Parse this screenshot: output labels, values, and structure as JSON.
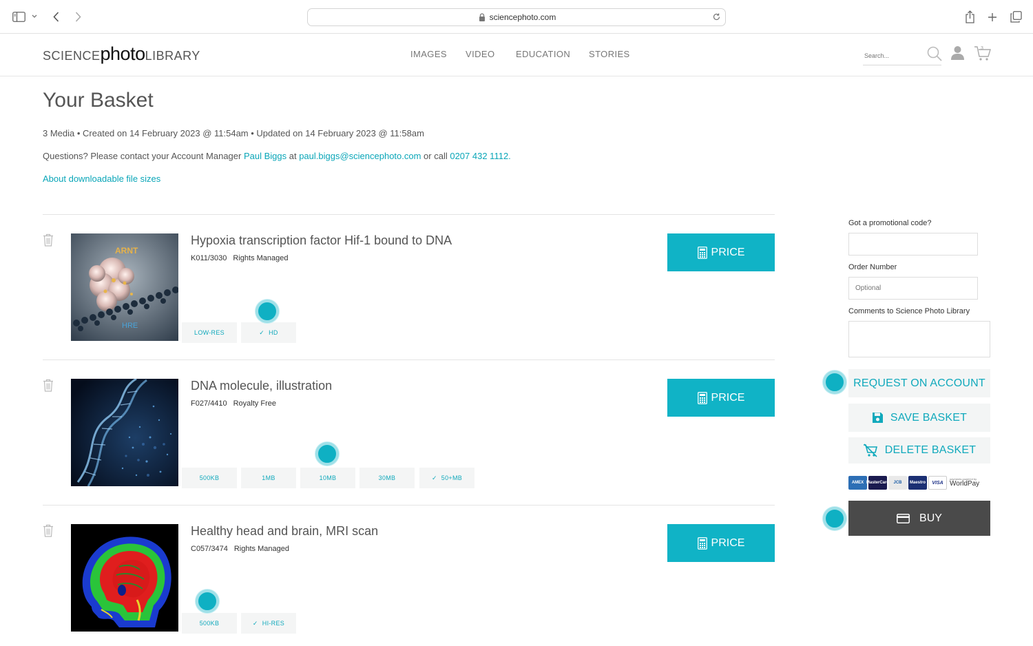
{
  "browser": {
    "url": "sciencephoto.com"
  },
  "header": {
    "logo": {
      "part1": "SCIENCE",
      "part2": "photo",
      "part3": "LIBRARY"
    },
    "nav": [
      "IMAGES",
      "VIDEO",
      "EDUCATION",
      "STORIES"
    ],
    "search_placeholder": "Search...",
    "cart_count": "3"
  },
  "page": {
    "title": "Your Basket",
    "meta": "3 Media • Created on 14 February 2023 @ 11:54am • Updated on 14 February 2023 @ 11:58am",
    "contact": {
      "prefix": "Questions? Please contact your Account Manager ",
      "manager": "Paul Biggs",
      "at": " at ",
      "email": "paul.biggs@sciencephoto.com",
      "or_call": " or call ",
      "phone": "0207 432 1112",
      "suffix": "."
    },
    "about_link": "About downloadable file sizes"
  },
  "items": [
    {
      "title": "Hypoxia transcription factor Hif-1 bound to DNA",
      "code": "K011/3030",
      "license": "Rights Managed",
      "price_label": "PRICE",
      "thumb_labels": [
        "ARNT",
        "HRE"
      ],
      "sizes": [
        {
          "label": "LOW-RES",
          "selected": false
        },
        {
          "label": "HD",
          "selected": true
        }
      ]
    },
    {
      "title": "DNA molecule, illustration",
      "code": "F027/4410",
      "license": "Royalty Free",
      "price_label": "PRICE",
      "sizes": [
        {
          "label": "500KB",
          "selected": false
        },
        {
          "label": "1MB",
          "selected": false
        },
        {
          "label": "10MB",
          "selected": false
        },
        {
          "label": "30MB",
          "selected": false
        },
        {
          "label": "50+MB",
          "selected": true
        }
      ]
    },
    {
      "title": "Healthy head and brain, MRI scan",
      "code": "C057/3474",
      "license": "Rights Managed",
      "price_label": "PRICE",
      "sizes": [
        {
          "label": "500KB",
          "selected": false
        },
        {
          "label": "HI-RES",
          "selected": true
        }
      ]
    }
  ],
  "sidebar": {
    "promo_label": "Got a promotional code?",
    "promo_value": "",
    "order_label": "Order Number",
    "order_placeholder": "Optional",
    "comments_label": "Comments to Science Photo Library",
    "request_label": "REQUEST ON ACCOUNT",
    "save_label": "SAVE BASKET",
    "delete_label": "DELETE BASKET",
    "buy_label": "BUY",
    "cards": [
      "AMEX",
      "MasterCard",
      "JCB",
      "Maestro",
      "VISA"
    ],
    "worldpay_small": "payments powered by",
    "worldpay": "WorldPay"
  },
  "colors": {
    "accent": "#10b3c6",
    "dark_button": "#4a4a4a"
  }
}
